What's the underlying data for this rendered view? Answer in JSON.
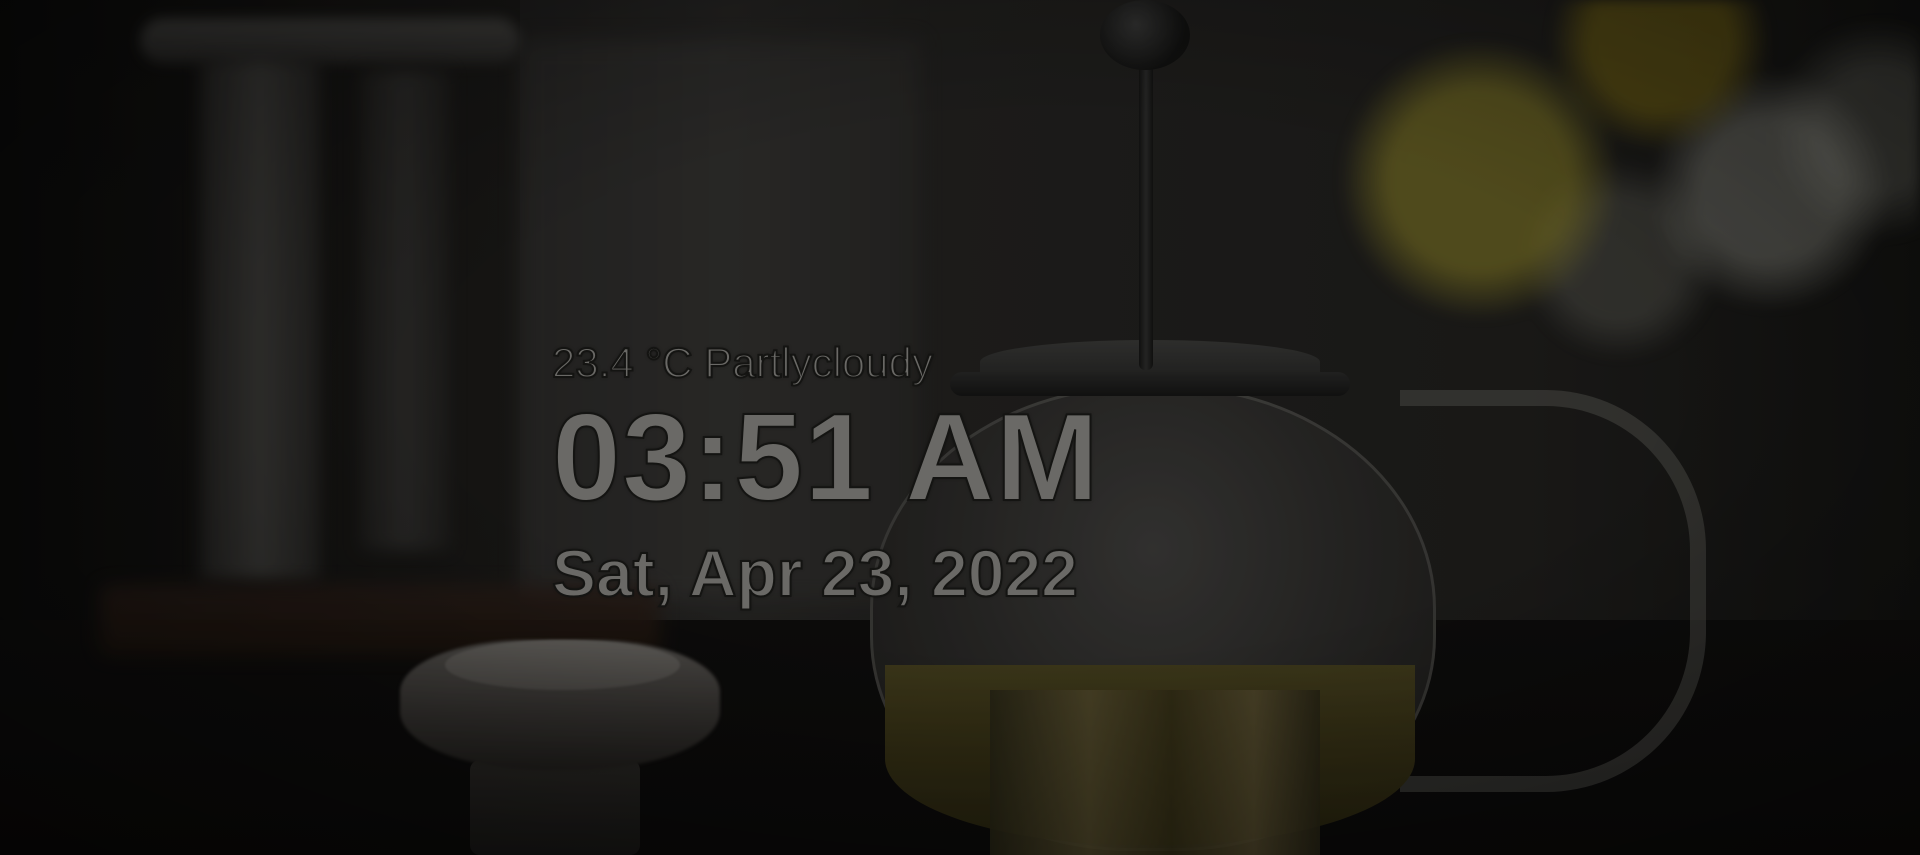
{
  "weather": {
    "temperature": "23.4 °C",
    "condition": "Partlycloudy"
  },
  "clock": {
    "time": "03:51 AM",
    "date": "Sat, Apr 23, 2022"
  },
  "colors": {
    "text": "#6a6966",
    "text_outline": "#141412"
  }
}
